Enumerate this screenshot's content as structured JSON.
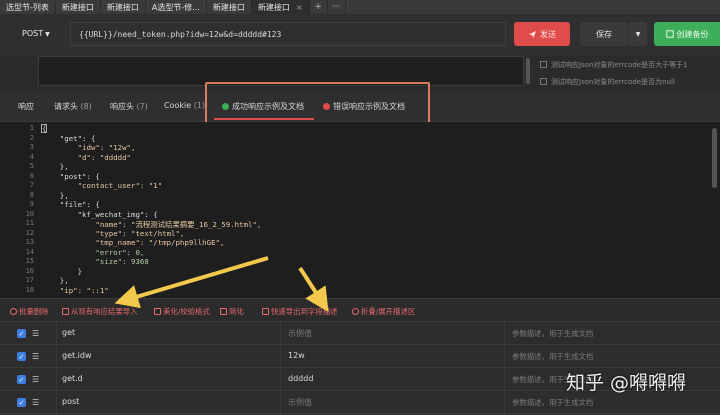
{
  "tabs": [
    {
      "label": "选型节-列表",
      "active": false
    },
    {
      "label": "新建接口",
      "active": false
    },
    {
      "label": "新建接口",
      "active": false
    },
    {
      "label": "A选型节-修...",
      "active": false
    },
    {
      "label": "新建接口",
      "active": false
    },
    {
      "label": "新建接口",
      "active": true
    }
  ],
  "tab_add": "+",
  "tab_more": "···",
  "tab_close": "×",
  "request": {
    "method": "POST",
    "url": "{{URL}}/need_token.php?idw=12w&d=ddddd#123",
    "send_label": "发送",
    "save_label": "保存",
    "backup_label": "创建备份"
  },
  "assertions": [
    "测试响应Json对象的errcode是否大于等于1",
    "测试响应Json对象的errcode是否为null"
  ],
  "response_tabs": [
    {
      "label": "响应",
      "count": ""
    },
    {
      "label": "请求头",
      "count": "(8)"
    },
    {
      "label": "响应头",
      "count": "(7)"
    },
    {
      "label": "Cookie",
      "count": "(1)"
    },
    {
      "label": "成功响应示例及文档",
      "count": ""
    },
    {
      "label": "错误响应示例及文档",
      "count": ""
    }
  ],
  "code_lines": [
    {
      "n": "1",
      "text": "{"
    },
    {
      "n": "2",
      "text": "    \"get\": {"
    },
    {
      "n": "3",
      "text": "        \"idw\": \"12w\","
    },
    {
      "n": "4",
      "text": "        \"d\": \"ddddd\""
    },
    {
      "n": "5",
      "text": "    },"
    },
    {
      "n": "6",
      "text": "    \"post\": {"
    },
    {
      "n": "7",
      "text": "        \"contact_user\": \"1\""
    },
    {
      "n": "8",
      "text": "    },"
    },
    {
      "n": "9",
      "text": "    \"file\": {"
    },
    {
      "n": "10",
      "text": "        \"kf_wechat_img\": {"
    },
    {
      "n": "11",
      "text": "            \"name\": \"流程测试结果摘要_16_2_59.html\","
    },
    {
      "n": "12",
      "text": "            \"type\": \"text/html\","
    },
    {
      "n": "13",
      "text": "            \"tmp_name\": \"/tmp/php9llhGE\","
    },
    {
      "n": "14",
      "text": "            \"error\": 0,"
    },
    {
      "n": "15",
      "text": "            \"size\": 9368"
    },
    {
      "n": "16",
      "text": "        }"
    },
    {
      "n": "17",
      "text": "    },"
    },
    {
      "n": "18",
      "text": "    \"ip\": \"::1\""
    }
  ],
  "toolbar": [
    "批量删除",
    "从现有响应结果导入",
    "美化/校验格式",
    "简化",
    "快速导出到字段描述",
    "折叠/展开描述区"
  ],
  "params": {
    "value_placeholder": "示例值",
    "desc_placeholder": "参数描述，用于生成文档",
    "rows": [
      {
        "name": "get",
        "value": ""
      },
      {
        "name": "get.idw",
        "value": "12w"
      },
      {
        "name": "get.d",
        "value": "ddddd"
      },
      {
        "name": "post",
        "value": ""
      }
    ]
  },
  "watermark": "知乎 @嘚嘚嘚",
  "colors": {
    "send": "#e04b4b",
    "backup": "#3fae5b",
    "checkbox": "#3d7fe0",
    "annotation_arrow": "#f2c94c",
    "highlight_box": "#e07a5f"
  }
}
